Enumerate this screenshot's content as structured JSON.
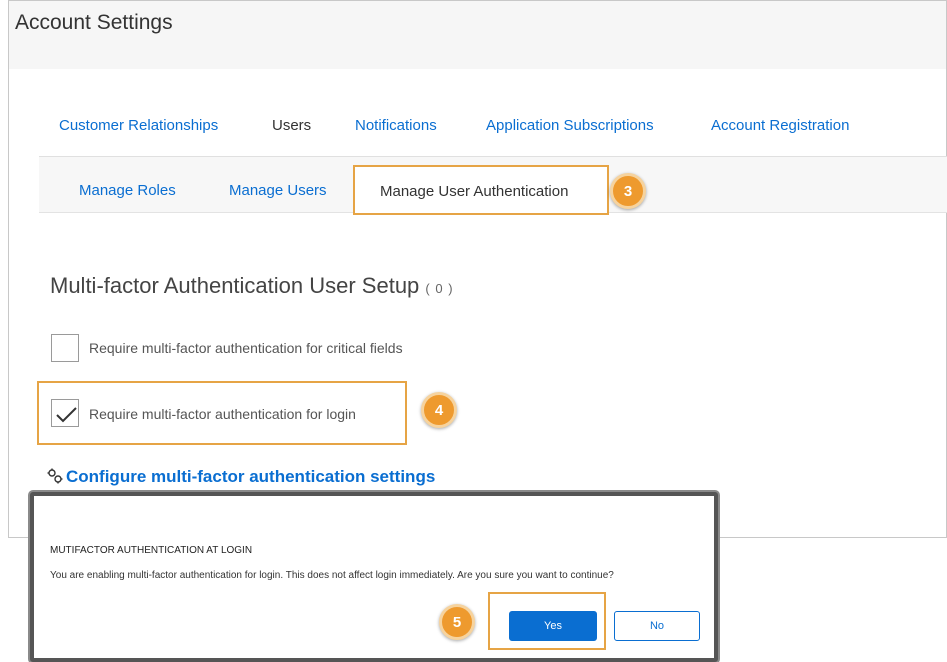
{
  "header": {
    "title": "Account Settings"
  },
  "top_tabs": [
    {
      "label": "Customer Relationships"
    },
    {
      "label": "Users"
    },
    {
      "label": "Notifications"
    },
    {
      "label": "Application Subscriptions"
    },
    {
      "label": "Account Registration"
    }
  ],
  "sub_tabs": [
    {
      "label": "Manage Roles"
    },
    {
      "label": "Manage Users"
    },
    {
      "label": "Manage User Authentication"
    }
  ],
  "section": {
    "title": "Multi-factor Authentication User Setup",
    "count": "( 0 )"
  },
  "options": [
    {
      "label": "Require multi-factor authentication for critical fields",
      "checked": false
    },
    {
      "label": "Require multi-factor authentication for login",
      "checked": true
    }
  ],
  "config_link": {
    "label": "Configure multi-factor authentication settings",
    "icon": "gears-icon"
  },
  "steps": [
    "3",
    "4",
    "5"
  ],
  "dialog": {
    "title": "MUTIFACTOR AUTHENTICATION AT LOGIN",
    "message": "You are enabling multi-factor authentication for login. This does not affect login immediately. Are you sure you want to continue?",
    "yes_label": "Yes",
    "no_label": "No"
  },
  "colors": {
    "link": "#0a6ed1",
    "highlight": "#e6a445",
    "badge": "#ee9a2e"
  }
}
